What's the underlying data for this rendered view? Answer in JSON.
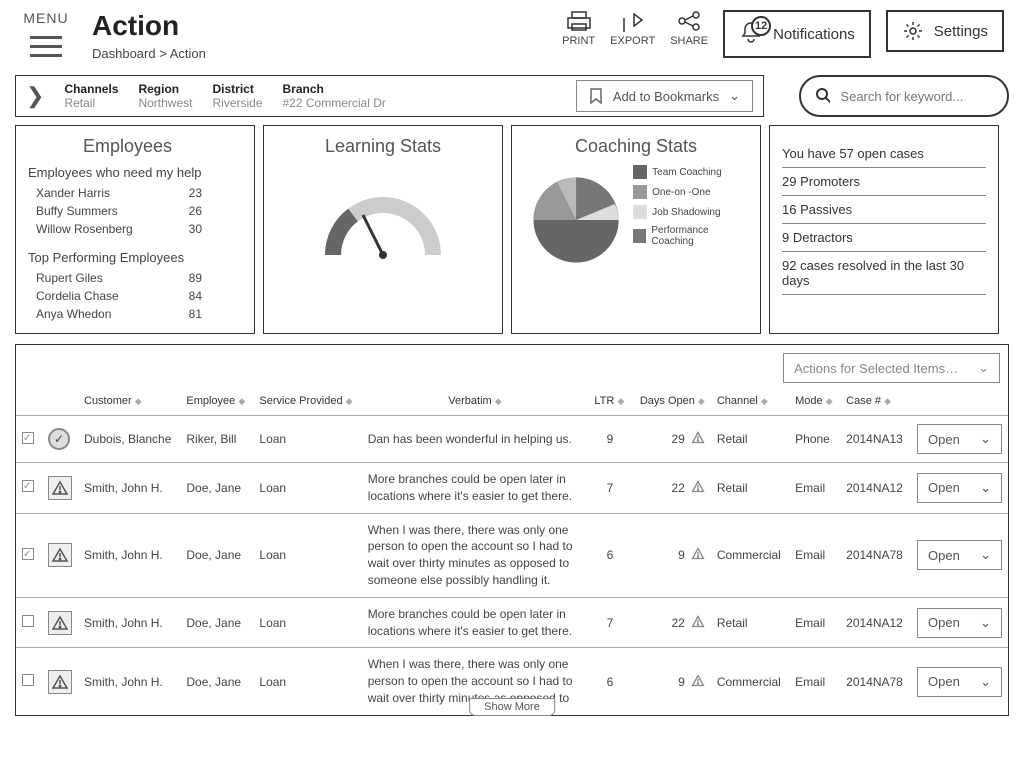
{
  "header": {
    "menu_label": "MENU",
    "title": "Action",
    "breadcrumb": "Dashboard > Action",
    "print": "PRINT",
    "export": "EXPORT",
    "share": "SHARE",
    "notifications": "Notifications",
    "notif_count": "12",
    "settings": "Settings"
  },
  "filters": {
    "channels_label": "Channels",
    "channels_value": "Retail",
    "region_label": "Region",
    "region_value": "Northwest",
    "district_label": "District",
    "district_value": "Riverside",
    "branch_label": "Branch",
    "branch_value": "#22 Commercial Dr",
    "bookmark": "Add to Bookmarks",
    "search_placeholder": "Search for keyword..."
  },
  "employees": {
    "title": "Employees",
    "help_title": "Employees who need my help",
    "help": [
      {
        "name": "Xander Harris",
        "score": "23"
      },
      {
        "name": "Buffy Summers",
        "score": "26"
      },
      {
        "name": "Willow Rosenberg",
        "score": "30"
      }
    ],
    "top_title": "Top Performing Employees",
    "top": [
      {
        "name": "Rupert Giles",
        "score": "89"
      },
      {
        "name": "Cordelia Chase",
        "score": "84"
      },
      {
        "name": "Anya Whedon",
        "score": "81"
      }
    ]
  },
  "learning": {
    "title": "Learning Stats"
  },
  "coaching": {
    "title": "Coaching Stats",
    "legend": [
      "Team Coaching",
      "One-on -One",
      "Job Shadowing",
      "Performance Coaching"
    ]
  },
  "stats": {
    "rows": [
      "You have 57 open cases",
      "29 Promoters",
      "16 Passives",
      "9 Detractors",
      "92 cases resolved in the last 30 days"
    ]
  },
  "table": {
    "actions_selected": "Actions for Selected Items…",
    "cols": {
      "customer": "Customer",
      "employee": "Employee",
      "service": "Service Provided",
      "verbatim": "Verbatim",
      "ltr": "LTR",
      "days": "Days Open",
      "channel": "Channel",
      "mode": "Mode",
      "case": "Case #"
    },
    "rows": [
      {
        "checked": true,
        "status": "check",
        "customer": "Dubois, Blanche",
        "employee": "Riker, Bill",
        "service": "Loan",
        "verbatim": "Dan has been wonderful in helping us.",
        "ltr": "9",
        "days": "29",
        "channel": "Retail",
        "mode": "Phone",
        "case": "2014NA13",
        "action": "Open"
      },
      {
        "checked": true,
        "status": "warn",
        "customer": "Smith, John H.",
        "employee": "Doe, Jane",
        "service": "Loan",
        "verbatim": "More branches could be open later in locations where it's easier to get there.",
        "ltr": "7",
        "days": "22",
        "channel": "Retail",
        "mode": "Email",
        "case": "2014NA12",
        "action": "Open"
      },
      {
        "checked": true,
        "status": "warn",
        "customer": "Smith, John H.",
        "employee": "Doe, Jane",
        "service": "Loan",
        "verbatim": "When I was there, there was only one person to open the account so I had to wait over thirty minutes as opposed to someone else possibly handling it.",
        "ltr": "6",
        "days": "9",
        "channel": "Commercial",
        "mode": "Email",
        "case": "2014NA78",
        "action": "Open"
      },
      {
        "checked": false,
        "status": "warn",
        "customer": "Smith, John H.",
        "employee": "Doe, Jane",
        "service": "Loan",
        "verbatim": "More branches could be open later in locations where it's easier to get there.",
        "ltr": "7",
        "days": "22",
        "channel": "Retail",
        "mode": "Email",
        "case": "2014NA12",
        "action": "Open"
      },
      {
        "checked": false,
        "status": "warn",
        "customer": "Smith, John H.",
        "employee": "Doe, Jane",
        "service": "Loan",
        "verbatim": "When I was there, there was only one person to open the account so I had to wait over thirty minutes as opposed to",
        "ltr": "6",
        "days": "9",
        "channel": "Commercial",
        "mode": "Email",
        "case": "2014NA78",
        "action": "Open"
      }
    ],
    "show_more": "Show More"
  },
  "chart_data": [
    {
      "type": "pie",
      "title": "Coaching Stats",
      "series": [
        {
          "name": "Team Coaching",
          "value": 50,
          "color": "#666"
        },
        {
          "name": "One-on -One",
          "value": 12,
          "color": "#999"
        },
        {
          "name": "Job Shadowing",
          "value": 18,
          "color": "#ddd"
        },
        {
          "name": "Performance Coaching",
          "value": 20,
          "color": "#777"
        }
      ]
    },
    {
      "type": "gauge",
      "title": "Learning Stats",
      "value": 35,
      "range": [
        0,
        100
      ]
    }
  ]
}
